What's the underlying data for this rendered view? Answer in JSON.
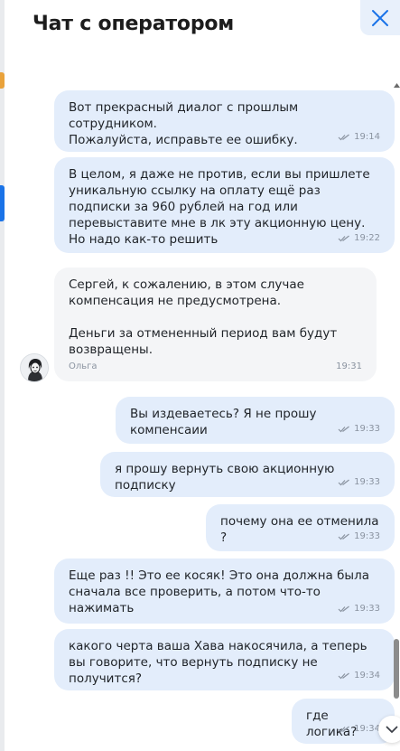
{
  "header": {
    "title": "Чат с оператором"
  },
  "messages": [
    {
      "direction": "out",
      "text": "Вот прекрасный диалог с прошлым сотрудником.\nПожалуйста, исправьте ее ошибку.",
      "time": "19:14"
    },
    {
      "direction": "out",
      "text": "В целом, я даже не против, если вы пришлете уникальную ссылку на оплату ещё раз подписки за 960 рублей на год или перевыставите мне в лк эту акционную цену. Но надо как-то решить",
      "time": "19:22"
    },
    {
      "direction": "in",
      "text": "Сергей, к сожалению, в этом случае компенсация не предусмотрена.\n\nДеньги за отмененный период вам будут возвращены.",
      "sender": "Ольга",
      "time": "19:31"
    },
    {
      "direction": "out",
      "text": "Вы издеваетесь? Я не прошу компенсаии",
      "time": "19:33"
    },
    {
      "direction": "out",
      "text": "я прошу вернуть свою акционную подписку",
      "time": "19:33"
    },
    {
      "direction": "out",
      "text": "почему она ее отменила ?",
      "time": "19:33"
    },
    {
      "direction": "out",
      "text": "Еще раз !! Это ее косяк! Это она должна была сначала все проверить, а потом что-то нажимать",
      "time": "19:33"
    },
    {
      "direction": "out",
      "text": "какого черта ваша Хава накосячила, а теперь вы говорите, что вернуть подписку не получится?",
      "time": "19:34"
    },
    {
      "direction": "out",
      "text": "где логика?",
      "time": "19:34"
    }
  ],
  "icons": {
    "close": "close-icon",
    "read_receipt": "double-check-icon",
    "scroll_down": "chevron-down-icon",
    "avatar": "operator-avatar"
  },
  "colors": {
    "outgoing_bubble": "#e3edfb",
    "incoming_bubble": "#f4f5f7",
    "accent": "#1a73e8"
  }
}
